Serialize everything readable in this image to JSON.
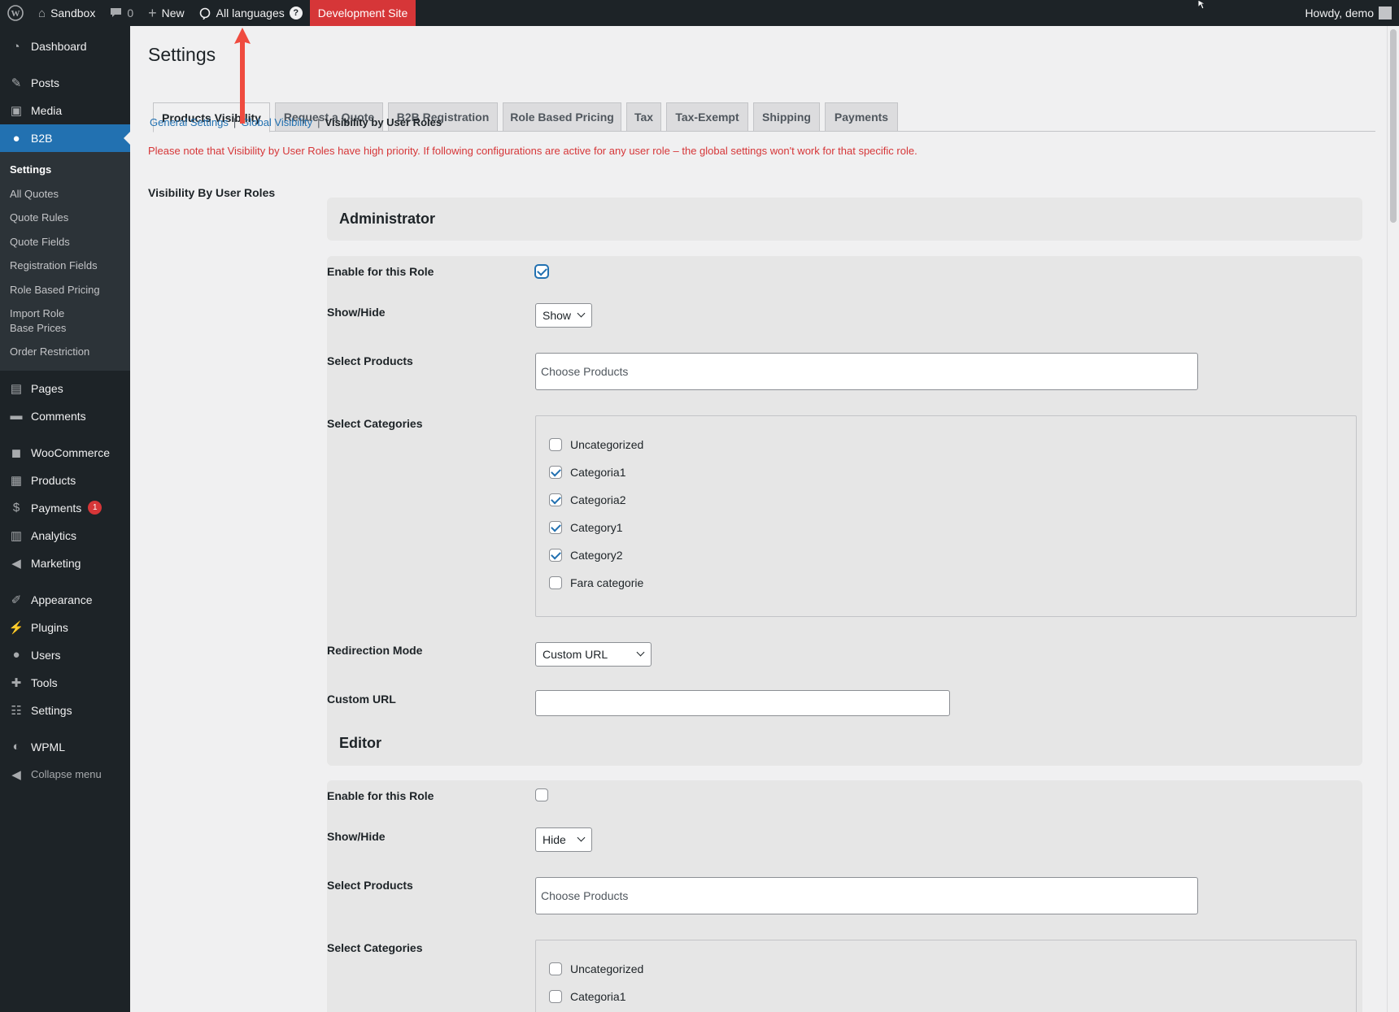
{
  "admin_bar": {
    "site_name": "Sandbox",
    "comments_count": "0",
    "new_label": "New",
    "languages_label": "All languages",
    "help_glyph": "?",
    "dev_site_label": "Development Site",
    "greeting": "Howdy, demo"
  },
  "sidebar": {
    "dashboard": "Dashboard",
    "posts": "Posts",
    "media": "Media",
    "b2b": "B2B",
    "b2b_sub": [
      "Settings",
      "All Quotes",
      "Quote Rules",
      "Quote Fields",
      "Registration Fields",
      "Role Based Pricing",
      "Import Role Base Prices",
      "Order Restriction"
    ],
    "pages": "Pages",
    "comments": "Comments",
    "woocommerce": "WooCommerce",
    "products": "Products",
    "payments": "Payments",
    "payments_badge": "1",
    "analytics": "Analytics",
    "marketing": "Marketing",
    "appearance": "Appearance",
    "plugins": "Plugins",
    "users": "Users",
    "tools": "Tools",
    "settings": "Settings",
    "wpml": "WPML",
    "collapse": "Collapse menu"
  },
  "page": {
    "title": "Settings",
    "tabs": [
      "Products Visibility",
      "Request a Quote",
      "B2B Registration",
      "Role Based Pricing",
      "Tax",
      "Tax-Exempt",
      "Shipping",
      "Payments"
    ],
    "active_tab": "Products Visibility",
    "subnav": {
      "general": "General Settings",
      "global": "Global Visibility",
      "current": "Visibility by User Roles",
      "sep": "|"
    },
    "notice": "Please note that Visibility by User Roles have high priority. If following configurations are active for any user role – the global settings won't work for that specific role.",
    "section_label": "Visibility By User Roles"
  },
  "labels": {
    "enable": "Enable for this Role",
    "show_hide": "Show/Hide",
    "select_products": "Select Products",
    "select_categories": "Select Categories",
    "redirection_mode": "Redirection Mode",
    "custom_url": "Custom URL"
  },
  "roles": {
    "administrator": {
      "name": "Administrator",
      "enabled": true,
      "show_hide": "Show",
      "products_placeholder": "Choose Products",
      "categories": [
        {
          "name": "Uncategorized",
          "checked": false
        },
        {
          "name": "Categoria1",
          "checked": true
        },
        {
          "name": "Categoria2",
          "checked": true
        },
        {
          "name": "Category1",
          "checked": true
        },
        {
          "name": "Category2",
          "checked": true
        },
        {
          "name": "Fara categorie",
          "checked": false
        }
      ],
      "redirection_mode": "Custom URL",
      "custom_url": ""
    },
    "editor": {
      "name": "Editor",
      "enabled": false,
      "show_hide": "Hide",
      "products_placeholder": "Choose Products",
      "categories": [
        {
          "name": "Uncategorized",
          "checked": false
        },
        {
          "name": "Categoria1",
          "checked": false
        }
      ]
    }
  },
  "colors": {
    "accent": "#2271b1",
    "notice": "#d63638",
    "annotation_arrow": "#ef4b3f"
  }
}
